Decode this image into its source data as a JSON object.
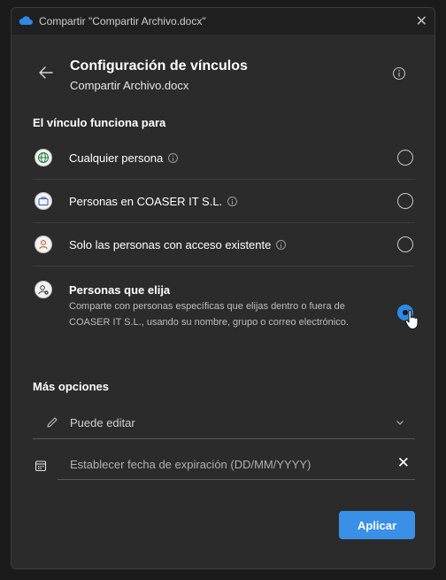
{
  "window": {
    "title": "Compartir \"Compartir Archivo.docx\""
  },
  "header": {
    "title": "Configuración de vínculos",
    "subtitle": "Compartir Archivo.docx"
  },
  "section": {
    "heading": "El vínculo funciona para"
  },
  "options": [
    {
      "label": "Cualquier persona",
      "icon": "globe-icon",
      "selected": false,
      "has_info": true
    },
    {
      "label": "Personas en COASER IT S.L.",
      "icon": "briefcase-icon",
      "selected": false,
      "has_info": true
    },
    {
      "label": "Solo las personas con acceso existente",
      "icon": "person-icon",
      "selected": false,
      "has_info": true
    },
    {
      "label": "Personas que elija",
      "icon": "person-settings-icon",
      "selected": true,
      "has_info": false,
      "description": "Comparte con personas específicas que elijas dentro o fuera de COASER IT S.L., usando su nombre, grupo o correo electrónico."
    }
  ],
  "more_options": {
    "heading": "Más opciones",
    "permission": "Puede editar",
    "expiration_placeholder": "Establecer fecha de expiración (DD/MM/YYYY)"
  },
  "apply_label": "Aplicar",
  "colors": {
    "accent": "#3a8fe6",
    "background": "#2b2b2b",
    "titlebar": "#202020"
  }
}
